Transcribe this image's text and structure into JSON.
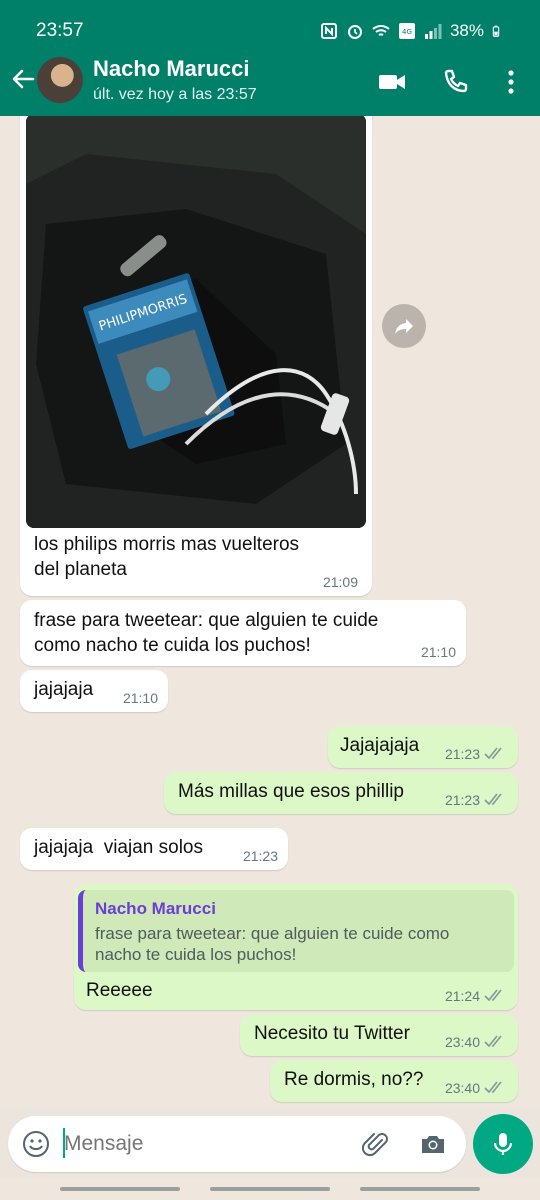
{
  "status_bar": {
    "time": "23:57",
    "battery": "38%"
  },
  "header": {
    "contact_name": "Nacho Marucci",
    "last_seen": "últ. vez hoy a las 23:57",
    "icons": [
      "back-arrow-icon",
      "video-call-icon",
      "voice-call-icon",
      "more-options-icon"
    ]
  },
  "messages": [
    {
      "direction": "in",
      "type": "image",
      "caption": "los philips morris mas vuelteros del planeta",
      "caption_line1": "los philips morris mas vuelteros",
      "caption_line2": "del planeta",
      "time": "21:09"
    },
    {
      "direction": "in",
      "line1": "frase para tweetear: que alguien te cuide",
      "line2": "como nacho te cuida los puchos!",
      "time": "21:10"
    },
    {
      "direction": "in",
      "text": "jajajaja",
      "time": "21:10"
    },
    {
      "direction": "out",
      "text": "Jajajajaja",
      "time": "21:23"
    },
    {
      "direction": "out",
      "text": "Más millas que esos phillip",
      "time": "21:23"
    },
    {
      "direction": "in",
      "text": "jajajaja  viajan solos",
      "time": "21:23"
    },
    {
      "direction": "out",
      "quote_name": "Nacho Marucci",
      "quote_line1": "frase para tweetear: que alguien te cuide como",
      "quote_line2": "nacho te cuida los puchos!",
      "text": "Reeeee",
      "time": "21:24"
    },
    {
      "direction": "out",
      "text": "Necesito tu Twitter",
      "time": "23:40"
    },
    {
      "direction": "out",
      "text": "Re dormis, no??",
      "time": "23:40"
    }
  ],
  "input": {
    "placeholder": "Mensaje"
  },
  "colors": {
    "header": "#008069",
    "outgoing": "#dcf8c6",
    "incoming": "#ffffff",
    "accent": "#00a884",
    "read_ticks": "#8696a0"
  }
}
